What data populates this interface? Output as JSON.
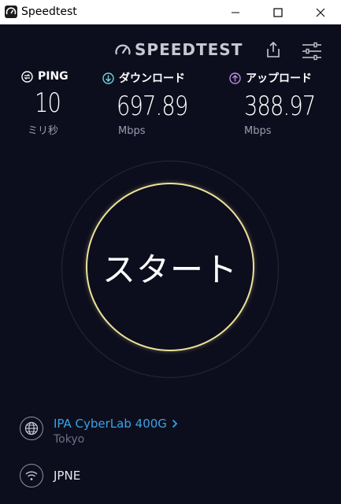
{
  "window": {
    "title": "Speedtest"
  },
  "header": {
    "logo_text": "SPEEDTEST"
  },
  "metrics": {
    "ping": {
      "label": "PING",
      "value": "10",
      "unit": "ミリ秒"
    },
    "download": {
      "label": "ダウンロード",
      "value": "697.89",
      "unit": "Mbps"
    },
    "upload": {
      "label": "アップロード",
      "value": "388.97",
      "unit": "Mbps"
    }
  },
  "gauge": {
    "start_label": "スタート",
    "ring_color": "#ede39a"
  },
  "server": {
    "name": "IPA CyberLab 400G",
    "location": "Tokyo"
  },
  "isp": {
    "name": "JPNE"
  },
  "colors": {
    "background": "#0d0e1d",
    "accent_link": "#3ba2e6",
    "download_icon": "#6fd3e0",
    "upload_icon": "#b98ce8"
  }
}
